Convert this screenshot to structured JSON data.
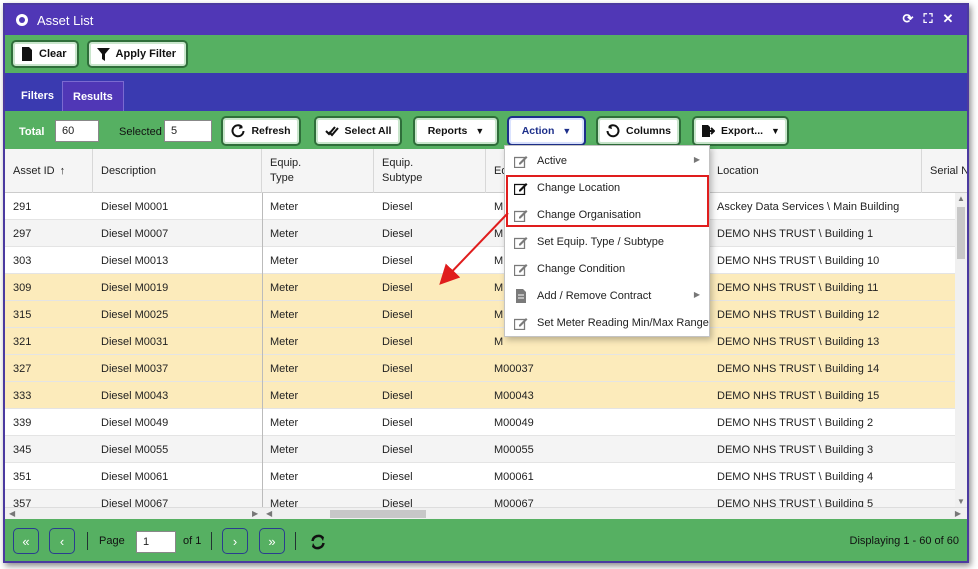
{
  "window": {
    "title": "Asset List"
  },
  "filterbar": {
    "clear_label": "Clear",
    "apply_filter_label": "Apply Filter"
  },
  "tabs": [
    {
      "label": "Filters"
    },
    {
      "label": "Results"
    }
  ],
  "toolbar": {
    "total_label": "Total",
    "total_value": "60",
    "selected_label": "Selected",
    "selected_value": "5",
    "refresh_label": "Refresh",
    "select_all_label": "Select All",
    "reports_label": "Reports",
    "action_label": "Action",
    "columns_label": "Columns",
    "export_label": "Export..."
  },
  "grid": {
    "headers": [
      "Asset ID",
      "Description",
      "Equip.\nType",
      "Equip.\nSubtype",
      "Eq",
      "Location",
      "Serial N"
    ],
    "rows": [
      {
        "id": "291",
        "description": "Diesel M0001",
        "type": "Meter",
        "subtype": "Diesel",
        "code": "M",
        "location": "Asckey Data Services \\ Main Building",
        "selected": false
      },
      {
        "id": "297",
        "description": "Diesel M0007",
        "type": "Meter",
        "subtype": "Diesel",
        "code": "M",
        "location": "DEMO NHS TRUST \\ Building 1",
        "selected": false
      },
      {
        "id": "303",
        "description": "Diesel M0013",
        "type": "Meter",
        "subtype": "Diesel",
        "code": "M",
        "location": "DEMO NHS TRUST \\ Building 10",
        "selected": false
      },
      {
        "id": "309",
        "description": "Diesel M0019",
        "type": "Meter",
        "subtype": "Diesel",
        "code": "M",
        "location": "DEMO NHS TRUST \\ Building 11",
        "selected": true
      },
      {
        "id": "315",
        "description": "Diesel M0025",
        "type": "Meter",
        "subtype": "Diesel",
        "code": "M",
        "location": "DEMO NHS TRUST \\ Building 12",
        "selected": true
      },
      {
        "id": "321",
        "description": "Diesel M0031",
        "type": "Meter",
        "subtype": "Diesel",
        "code": "M",
        "location": "DEMO NHS TRUST \\ Building 13",
        "selected": true
      },
      {
        "id": "327",
        "description": "Diesel M0037",
        "type": "Meter",
        "subtype": "Diesel",
        "code": "M00037",
        "location": "DEMO NHS TRUST \\ Building 14",
        "selected": true
      },
      {
        "id": "333",
        "description": "Diesel M0043",
        "type": "Meter",
        "subtype": "Diesel",
        "code": "M00043",
        "location": "DEMO NHS TRUST \\ Building 15",
        "selected": true
      },
      {
        "id": "339",
        "description": "Diesel M0049",
        "type": "Meter",
        "subtype": "Diesel",
        "code": "M00049",
        "location": "DEMO NHS TRUST \\ Building 2",
        "selected": false
      },
      {
        "id": "345",
        "description": "Diesel M0055",
        "type": "Meter",
        "subtype": "Diesel",
        "code": "M00055",
        "location": "DEMO NHS TRUST \\ Building 3",
        "selected": false
      },
      {
        "id": "351",
        "description": "Diesel M0061",
        "type": "Meter",
        "subtype": "Diesel",
        "code": "M00061",
        "location": "DEMO NHS TRUST \\ Building 4",
        "selected": false
      },
      {
        "id": "357",
        "description": "Diesel M0067",
        "type": "Meter",
        "subtype": "Diesel",
        "code": "M00067",
        "location": "DEMO NHS TRUST \\ Building 5",
        "selected": false
      }
    ]
  },
  "action_menu": [
    {
      "label": "Active",
      "icon": "edit-icon",
      "submenu": true
    },
    {
      "label": "Change Location",
      "icon": "edit-icon",
      "submenu": false,
      "active": true
    },
    {
      "label": "Change Organisation",
      "icon": "edit-icon",
      "submenu": false
    },
    {
      "label": "Set Equip. Type / Subtype",
      "icon": "edit-icon",
      "submenu": false
    },
    {
      "label": "Change Condition",
      "icon": "edit-icon",
      "submenu": false
    },
    {
      "label": "Add / Remove Contract",
      "icon": "document-icon",
      "submenu": true
    },
    {
      "label": "Set Meter Reading Min/Max Range",
      "icon": "edit-icon",
      "submenu": false
    }
  ],
  "pager": {
    "page_label": "Page",
    "page_value": "1",
    "of_label": "of 1",
    "display_text": "Displaying 1 - 60 of 60"
  },
  "colors": {
    "title_bar": "#5037b6",
    "toolbar_green": "#56b062",
    "tab_bar": "#3a3ab0",
    "selected_row": "#fcebbb",
    "highlight_red": "#e01d1d"
  }
}
